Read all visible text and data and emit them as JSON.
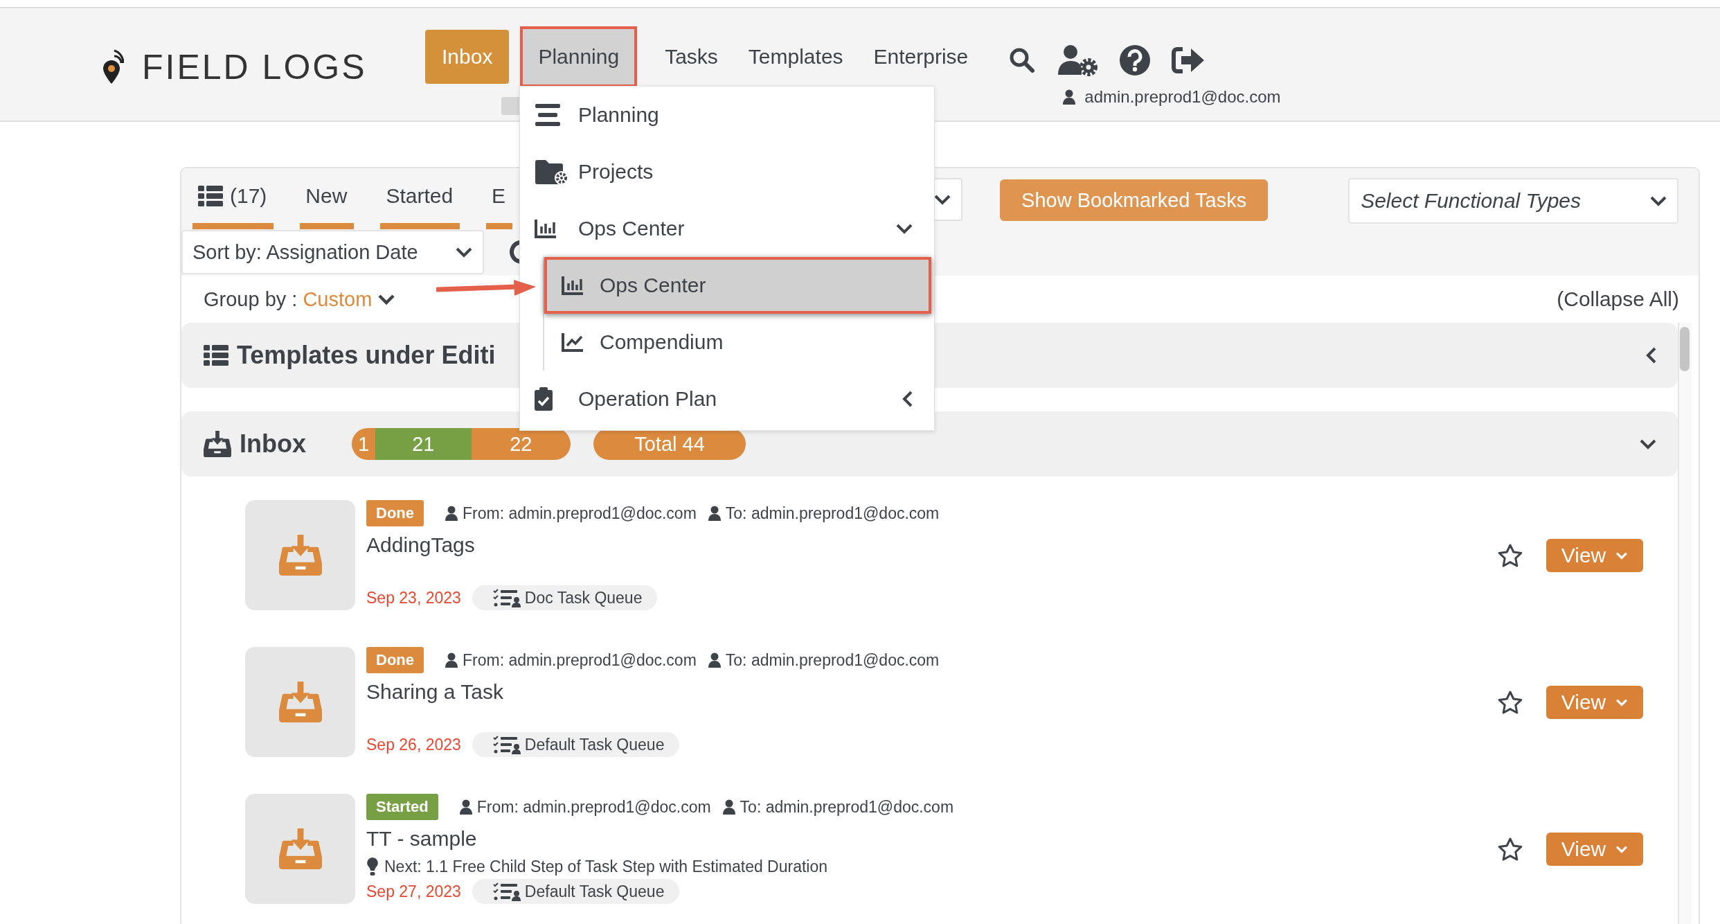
{
  "header": {
    "logo": "FIELD LOGS",
    "nav": [
      {
        "label": "Inbox",
        "selected": true,
        "open": false,
        "annotated": false
      },
      {
        "label": "Planning",
        "selected": false,
        "open": true,
        "annotated": true
      },
      {
        "label": "Tasks",
        "selected": false,
        "open": false,
        "annotated": false
      },
      {
        "label": "Templates",
        "selected": false,
        "open": false,
        "annotated": false
      },
      {
        "label": "Enterprise",
        "selected": false,
        "open": false,
        "annotated": false
      }
    ],
    "user": "admin.preprod1@doc.com"
  },
  "planning_menu": {
    "items": [
      {
        "label": "Planning",
        "kind": "item"
      },
      {
        "label": "Projects",
        "kind": "item"
      },
      {
        "label": "Ops Center",
        "kind": "group",
        "expanded": true,
        "children": [
          {
            "label": "Ops Center",
            "selected": true,
            "annotated": true
          },
          {
            "label": "Compendium",
            "selected": false,
            "annotated": false
          }
        ]
      },
      {
        "label": "Operation Plan",
        "kind": "group",
        "expanded": false
      }
    ]
  },
  "toolbar": {
    "tabs": [
      {
        "label": "(17)"
      },
      {
        "label": "New"
      },
      {
        "label": "Started"
      },
      {
        "label": "E"
      }
    ],
    "bookmark_button": "Show Bookmarked Tasks",
    "functional_types": {
      "placeholder": "Select Functional Types"
    },
    "sort": {
      "value": "Sort by: Assignation Date"
    }
  },
  "grouping": {
    "label": "Group by :",
    "value": "Custom",
    "collapse_all": "(Collapse All)"
  },
  "sections": [
    {
      "title": "Templates under Editi",
      "expanded": false
    },
    {
      "title": "Inbox",
      "expanded": true,
      "counts": [
        {
          "label": "1",
          "color": "#dc8a3e"
        },
        {
          "label": "21",
          "color": "#76a043"
        },
        {
          "label": "22",
          "color": "#dc8a3e"
        }
      ],
      "total": "Total 44",
      "tasks": [
        {
          "status": "Done",
          "color": "#dc8a3e",
          "from": "From: admin.preprod1@doc.com",
          "to": "To: admin.preprod1@doc.com",
          "title": "AddingTags",
          "date": "Sep 23, 2023",
          "queue": "Doc Task Queue",
          "bookmarked": false,
          "action": "View"
        },
        {
          "status": "Done",
          "color": "#dc8a3e",
          "from": "From: admin.preprod1@doc.com",
          "to": "To: admin.preprod1@doc.com",
          "title": "Sharing a Task",
          "date": "Sep 26, 2023",
          "queue": "Default Task Queue",
          "bookmarked": false,
          "action": "View"
        },
        {
          "status": "Started",
          "color": "#76a043",
          "from": "From: admin.preprod1@doc.com",
          "to": "To: admin.preprod1@doc.com",
          "title": "TT - sample",
          "next": "Next: 1.1 Free Child Step of Task Step with Estimated Duration",
          "date": "Sep 27, 2023",
          "queue": "Default Task Queue",
          "bookmarked": false,
          "action": "View"
        }
      ]
    }
  ]
}
